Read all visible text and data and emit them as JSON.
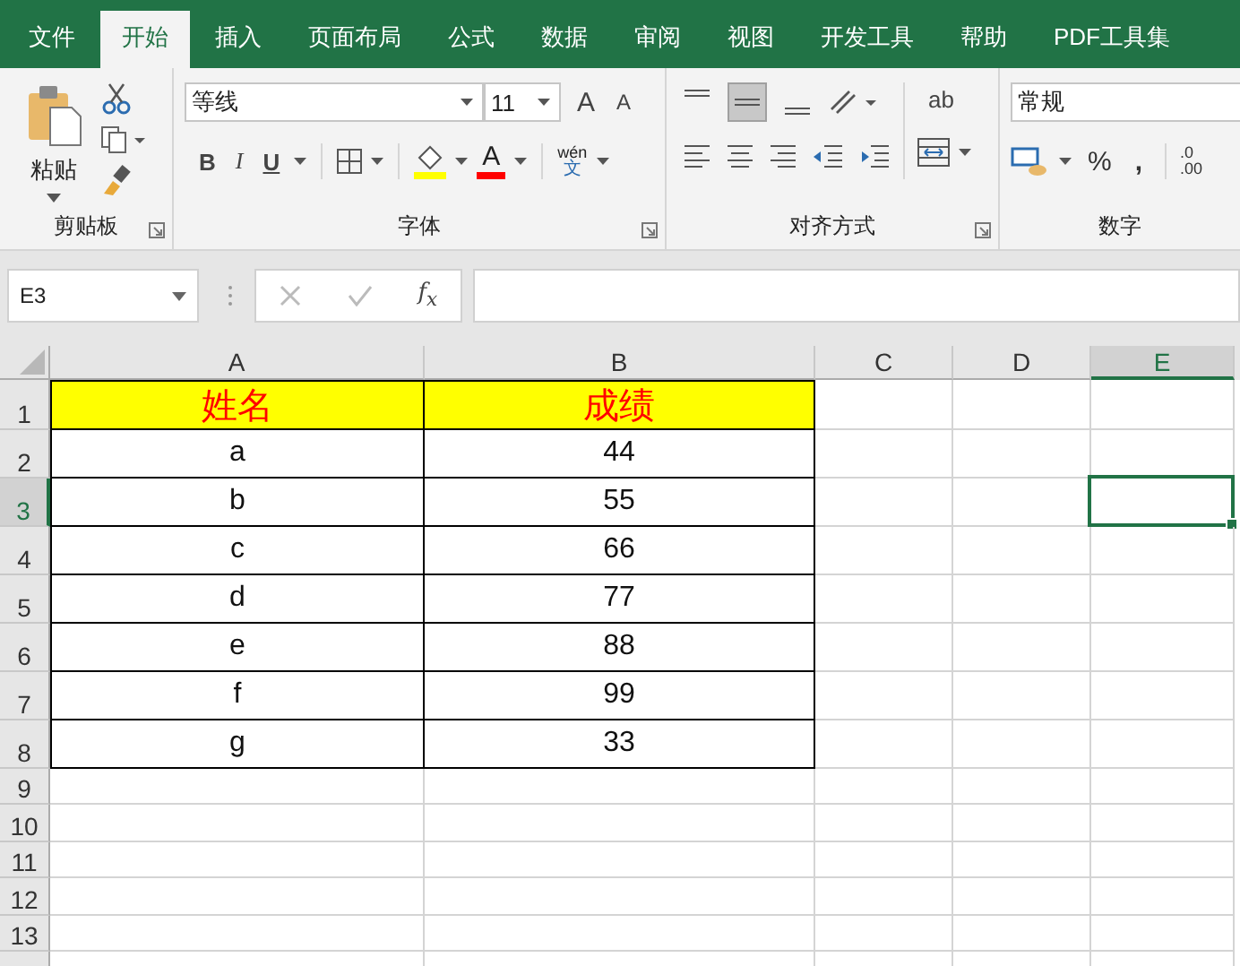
{
  "tabs": [
    {
      "label": "文件",
      "selected": false
    },
    {
      "label": "开始",
      "selected": true
    },
    {
      "label": "插入",
      "selected": false
    },
    {
      "label": "页面布局",
      "selected": false
    },
    {
      "label": "公式",
      "selected": false
    },
    {
      "label": "数据",
      "selected": false
    },
    {
      "label": "审阅",
      "selected": false
    },
    {
      "label": "视图",
      "selected": false
    },
    {
      "label": "开发工具",
      "selected": false
    },
    {
      "label": "帮助",
      "selected": false
    },
    {
      "label": "PDF工具集",
      "selected": false
    }
  ],
  "ribbon": {
    "clipboard": {
      "paste": "粘贴",
      "label": "剪贴板"
    },
    "font": {
      "font_name": "等线",
      "font_size": "11",
      "grow": "A",
      "shrink": "A",
      "bold": "B",
      "italic": "I",
      "underline": "U",
      "font_color": "A",
      "phonetic_top": "wén",
      "phonetic_bottom": "文",
      "label": "字体"
    },
    "alignment": {
      "vertical_align": [
        {
          "selected": false
        },
        {
          "selected": true
        },
        {
          "selected": false
        }
      ],
      "wrap_text": "ab",
      "label": "对齐方式"
    },
    "number": {
      "format": "常规",
      "percent": "%",
      "comma": ",",
      "decimal_top": ".0",
      "decimal_bottom": ".00",
      "label": "数字"
    }
  },
  "formula_bar": {
    "name_box": "E3",
    "fx": "f$_{x}$"
  },
  "grid": {
    "columns": [
      {
        "label": "A",
        "selected": false
      },
      {
        "label": "B",
        "selected": false
      },
      {
        "label": "C",
        "selected": false
      },
      {
        "label": "D",
        "selected": false
      },
      {
        "label": "E",
        "selected": true
      }
    ],
    "rows": [
      {
        "label": "1",
        "kind": "header",
        "selected": false,
        "cells": [
          "姓名",
          "成绩"
        ]
      },
      {
        "label": "2",
        "kind": "data",
        "selected": false,
        "cells": [
          "a",
          "44"
        ]
      },
      {
        "label": "3",
        "kind": "data",
        "selected": true,
        "cells": [
          "b",
          "55"
        ]
      },
      {
        "label": "4",
        "kind": "data",
        "selected": false,
        "cells": [
          "c",
          "66"
        ]
      },
      {
        "label": "5",
        "kind": "data",
        "selected": false,
        "cells": [
          "d",
          "77"
        ]
      },
      {
        "label": "6",
        "kind": "data",
        "selected": false,
        "cells": [
          "e",
          "88"
        ]
      },
      {
        "label": "7",
        "kind": "data",
        "selected": false,
        "cells": [
          "f",
          "99"
        ]
      },
      {
        "label": "8",
        "kind": "data",
        "selected": false,
        "cells": [
          "g",
          "33"
        ]
      },
      {
        "label": "9",
        "kind": "empty",
        "selected": false,
        "cells": []
      },
      {
        "label": "10",
        "kind": "empty",
        "selected": false,
        "cells": []
      },
      {
        "label": "11",
        "kind": "empty",
        "selected": false,
        "cells": []
      },
      {
        "label": "12",
        "kind": "empty",
        "selected": false,
        "cells": []
      },
      {
        "label": "13",
        "kind": "empty",
        "selected": false,
        "cells": []
      }
    ]
  }
}
